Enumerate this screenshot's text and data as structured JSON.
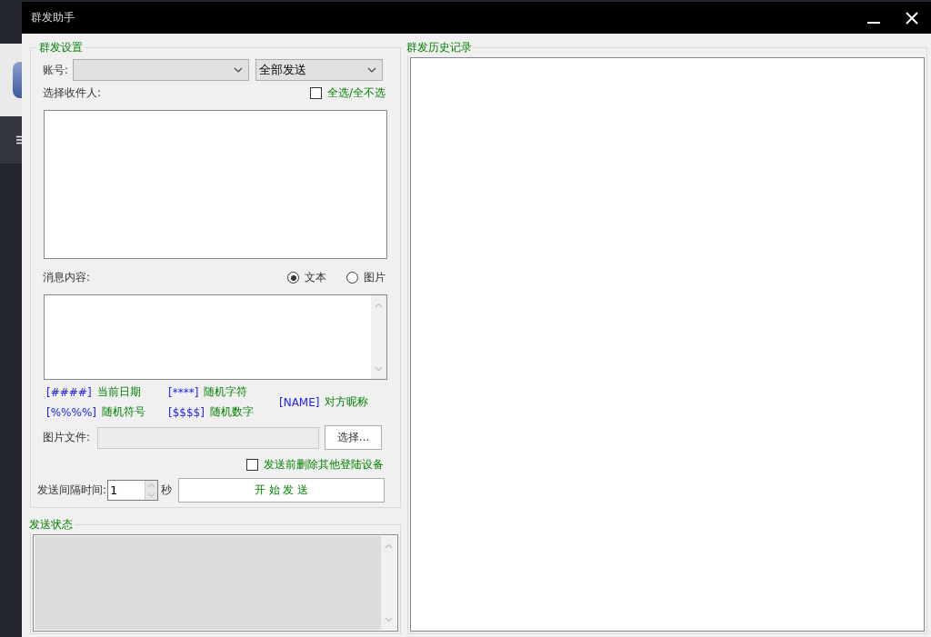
{
  "window": {
    "title": "群发助手"
  },
  "settings": {
    "title": "群发设置",
    "account_label": "账号:",
    "mode_select": "全部发送",
    "recipients_label": "选择收件人:",
    "select_all": {
      "label": "全选/全不选",
      "checked": false
    },
    "message_label": "消息内容:",
    "message_types": [
      {
        "label": "文本",
        "selected": true
      },
      {
        "label": "图片",
        "selected": false
      }
    ],
    "tokens": [
      {
        "code": "[####]",
        "meaning": "当前日期"
      },
      {
        "code": "[****]",
        "meaning": "随机字符"
      },
      {
        "code": "[NAME]",
        "meaning": "对方昵称"
      },
      {
        "code": "[%%%%]",
        "meaning": "随机符号"
      },
      {
        "code": "[$$$$]",
        "meaning": "随机数字"
      }
    ],
    "image_file_label": "图片文件:",
    "choose_button": "选择...",
    "delete_devices": {
      "label": "发送前删除其他登陆设备",
      "checked": false
    },
    "interval_label": "发送间隔时间:",
    "interval_value": "1",
    "interval_unit": "秒",
    "start_button": "开 始 发 送"
  },
  "status": {
    "title": "发送状态"
  },
  "history": {
    "title": "群发历史记录"
  }
}
